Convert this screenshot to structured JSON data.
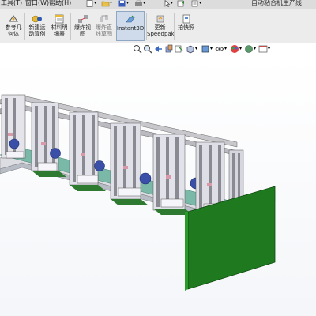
{
  "menubar": {
    "items": [
      "工具(T)",
      "窗口(W)",
      "帮助(H)"
    ],
    "document_title": "自动粘合机生产线"
  },
  "ribbon": {
    "buttons": [
      {
        "label": "参考几\n何体",
        "icon": "reference-geometry-icon"
      },
      {
        "label": "新建运\n动算例",
        "icon": "new-motion-study-icon"
      },
      {
        "label": "材料明\n细表",
        "icon": "bill-of-materials-icon"
      },
      {
        "label": "爆炸视\n图",
        "icon": "exploded-view-icon"
      },
      {
        "label": "爆炸直\n线草图",
        "icon": "explode-line-sketch-icon"
      },
      {
        "label": "Instant3D",
        "icon": "instant3d-icon",
        "active": true
      },
      {
        "label": "更新\nSpeedpak",
        "icon": "update-speedpak-icon"
      },
      {
        "label": "拍快照",
        "icon": "take-snapshot-icon"
      }
    ]
  },
  "view_toolbar": {
    "icons": [
      "zoom-to-fit-icon",
      "zoom-to-area-icon",
      "previous-view-icon",
      "section-view-icon",
      "dynamic-annotation-icon",
      "view-orientation-icon",
      "display-style-icon",
      "hide-show-items-icon",
      "edit-appearance-icon",
      "apply-scene-icon",
      "view-settings-icon"
    ]
  },
  "colors": {
    "green_panel": "#1f7a1f",
    "machine_blue": "#3a4fa8",
    "frame_grey": "#c8c8cc",
    "active_button": "#cfdbea"
  }
}
